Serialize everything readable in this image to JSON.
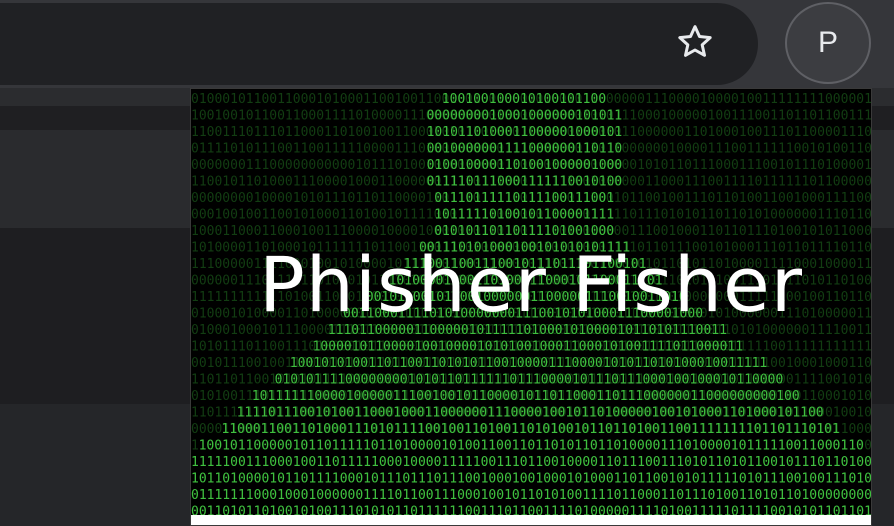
{
  "browser": {
    "profile_initial": "P",
    "bookmark_icon": "star-outline-icon"
  },
  "popup": {
    "banner_title": "Phisher Fisher",
    "banner_background": "binary-matrix-hooded-figure"
  },
  "colors": {
    "toolbar": "#35363a",
    "omnibox": "#202124",
    "matrix_green": "#3fbf3f",
    "banner_text": "#ffffff"
  }
}
